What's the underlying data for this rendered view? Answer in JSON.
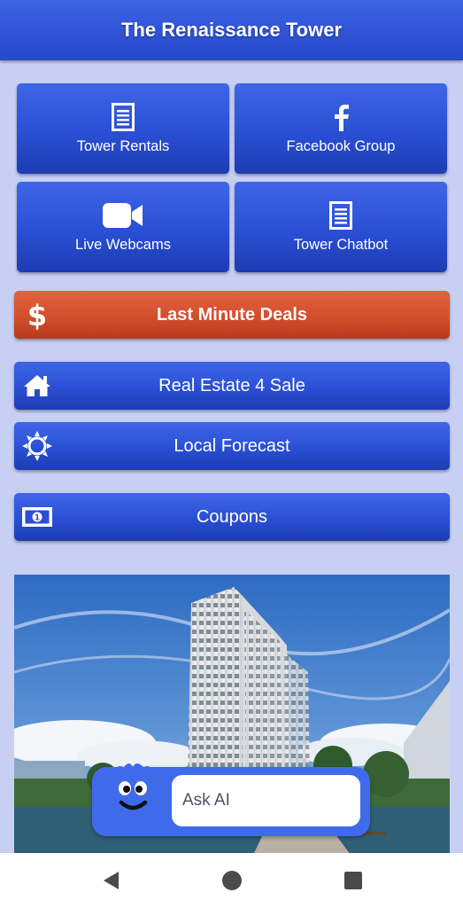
{
  "header": {
    "title": "The Renaissance Tower"
  },
  "tiles": [
    {
      "label": "Tower Rentals",
      "icon": "document-icon"
    },
    {
      "label": "Facebook Group",
      "icon": "facebook-icon"
    },
    {
      "label": "Live Webcams",
      "icon": "video-camera-icon"
    },
    {
      "label": "Tower Chatbot",
      "icon": "document-icon"
    }
  ],
  "bars": [
    {
      "label": "Last Minute Deals",
      "icon": "dollar-icon",
      "color": "#d24e2c"
    },
    {
      "label": "Real Estate 4 Sale",
      "icon": "home-icon"
    },
    {
      "label": "Local Forecast",
      "icon": "sun-icon"
    },
    {
      "label": "Coupons",
      "icon": "money-bill-icon"
    }
  ],
  "chat": {
    "placeholder": "Ask AI",
    "avatar": "smiley-bot-icon"
  },
  "colors": {
    "accent": "#2a4fd4",
    "background": "#c7d0f3",
    "deals": "#d24e2c"
  },
  "nav": [
    "back-icon",
    "home-circle-icon",
    "recents-icon"
  ]
}
